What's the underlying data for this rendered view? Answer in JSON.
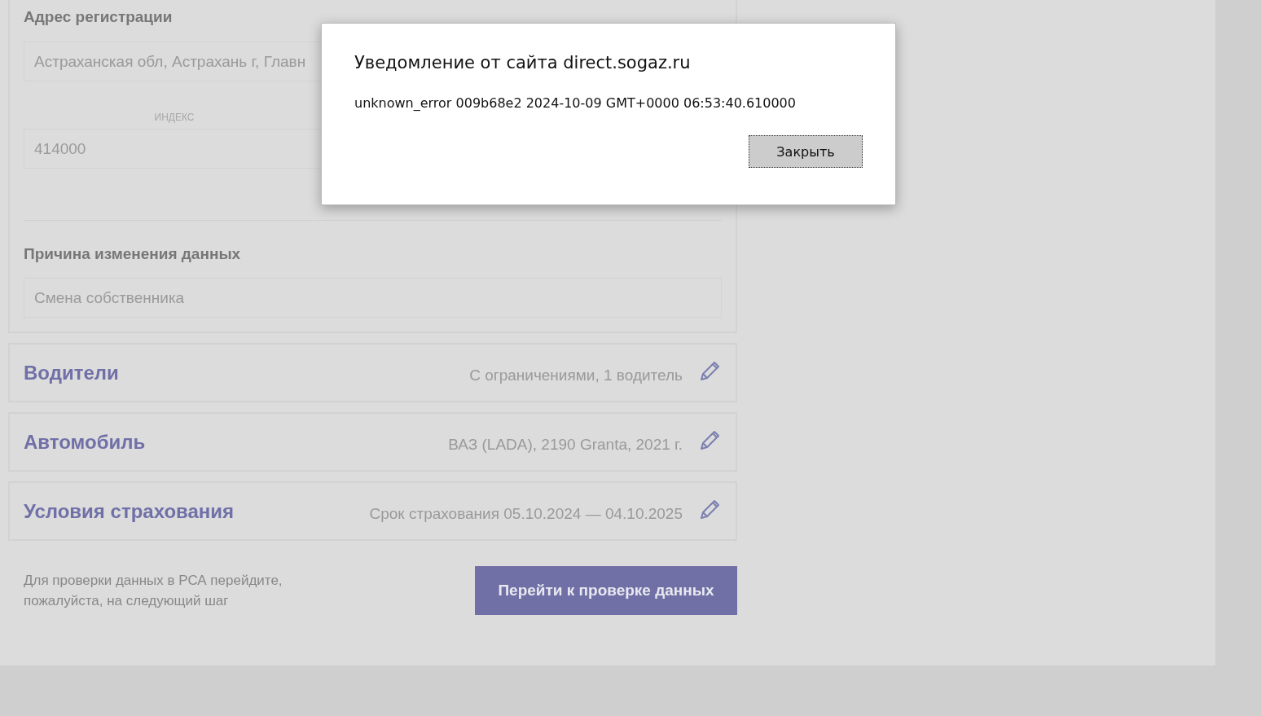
{
  "form": {
    "address_label": "Адрес регистрации",
    "address_value": "Астраханская обл, Астрахань г, Главн",
    "index_label": "ИНДЕКС",
    "index_value": "414000",
    "reason_label": "Причина изменения данных",
    "reason_value": "Смена собственника"
  },
  "sections": [
    {
      "title": "Водители",
      "summary": "С ограничениями, 1 водитель"
    },
    {
      "title": "Автомобиль",
      "summary": "ВАЗ (LADA), 2190 Granta, 2021 г."
    },
    {
      "title": "Условия страхования",
      "summary": "Срок страхования 05.10.2024 — 04.10.2025"
    }
  ],
  "footer": {
    "hint": "Для проверки данных в РСА перейдите, пожалуйста, на следующий шаг",
    "button": "Перейти к проверке данных"
  },
  "dialog": {
    "title": "Уведомление от сайта direct.sogaz.ru",
    "message": "unknown_error 009b68e2 2024-10-09 GMT+0000 06:53:40.610000",
    "button": "Закрыть"
  }
}
